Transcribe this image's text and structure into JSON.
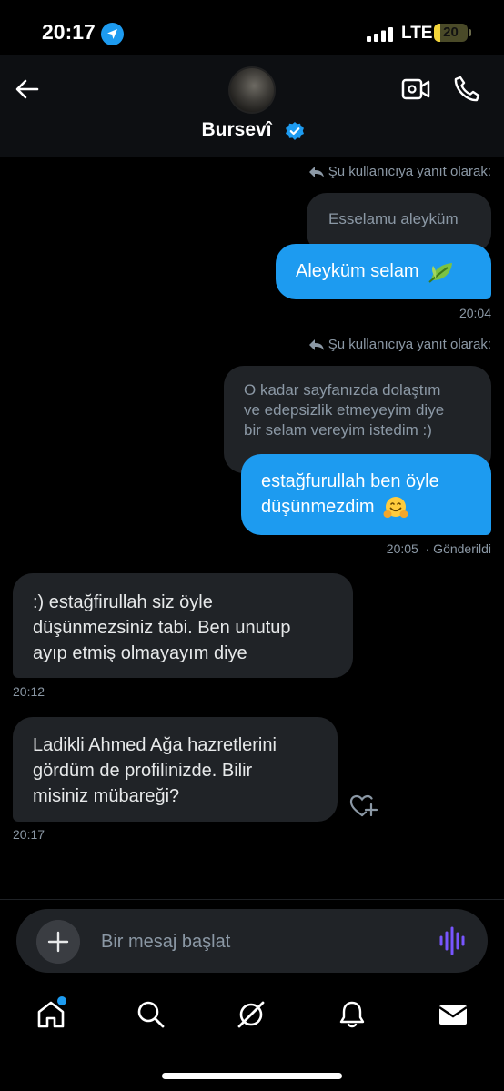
{
  "status_bar": {
    "time": "20:17",
    "network": "LTE",
    "battery": "20",
    "battery_level": 0.2
  },
  "header": {
    "contact_name": "Bursevî",
    "verified": true
  },
  "messages": {
    "group1": {
      "reply_note": "Şu kullanıcıya yanıt olarak:",
      "quoted": "Esselamu aleyküm",
      "text": "Aleyküm selam",
      "emoji": "leaf",
      "time": "20:04"
    },
    "group2": {
      "reply_note": "Şu kullanıcıya yanıt olarak:",
      "quoted_lines": [
        "O kadar sayfanızda dolaştım",
        "ve edepsizlik etmeyeyim diye",
        "bir selam vereyim istedim :)"
      ],
      "lines": [
        "estağfurullah ben öyle",
        "düşünmezdim"
      ],
      "emoji": "hugging-face",
      "time": "20:05",
      "status": "· Gönderildi"
    },
    "incoming1": {
      "lines": [
        ":) estağfirullah siz öyle",
        "düşünmezsiniz tabi. Ben unutup",
        "ayıp etmiş olmayayım diye"
      ],
      "time": "20:12"
    },
    "incoming2": {
      "lines": [
        "Ladikli Ahmed Ağa hazretlerini",
        "gördüm de profilinizde. Bilir",
        "misiniz mübareği?"
      ],
      "time": "20:17"
    }
  },
  "composer": {
    "placeholder": "Bir mesaj başlat"
  },
  "colors": {
    "accent": "#1d9bf0",
    "bubble_in": "#202327",
    "voice": "#7856ff"
  },
  "nav": {
    "items": [
      "home-icon",
      "search-icon",
      "grok-icon",
      "notifications-icon",
      "messages-icon"
    ]
  }
}
